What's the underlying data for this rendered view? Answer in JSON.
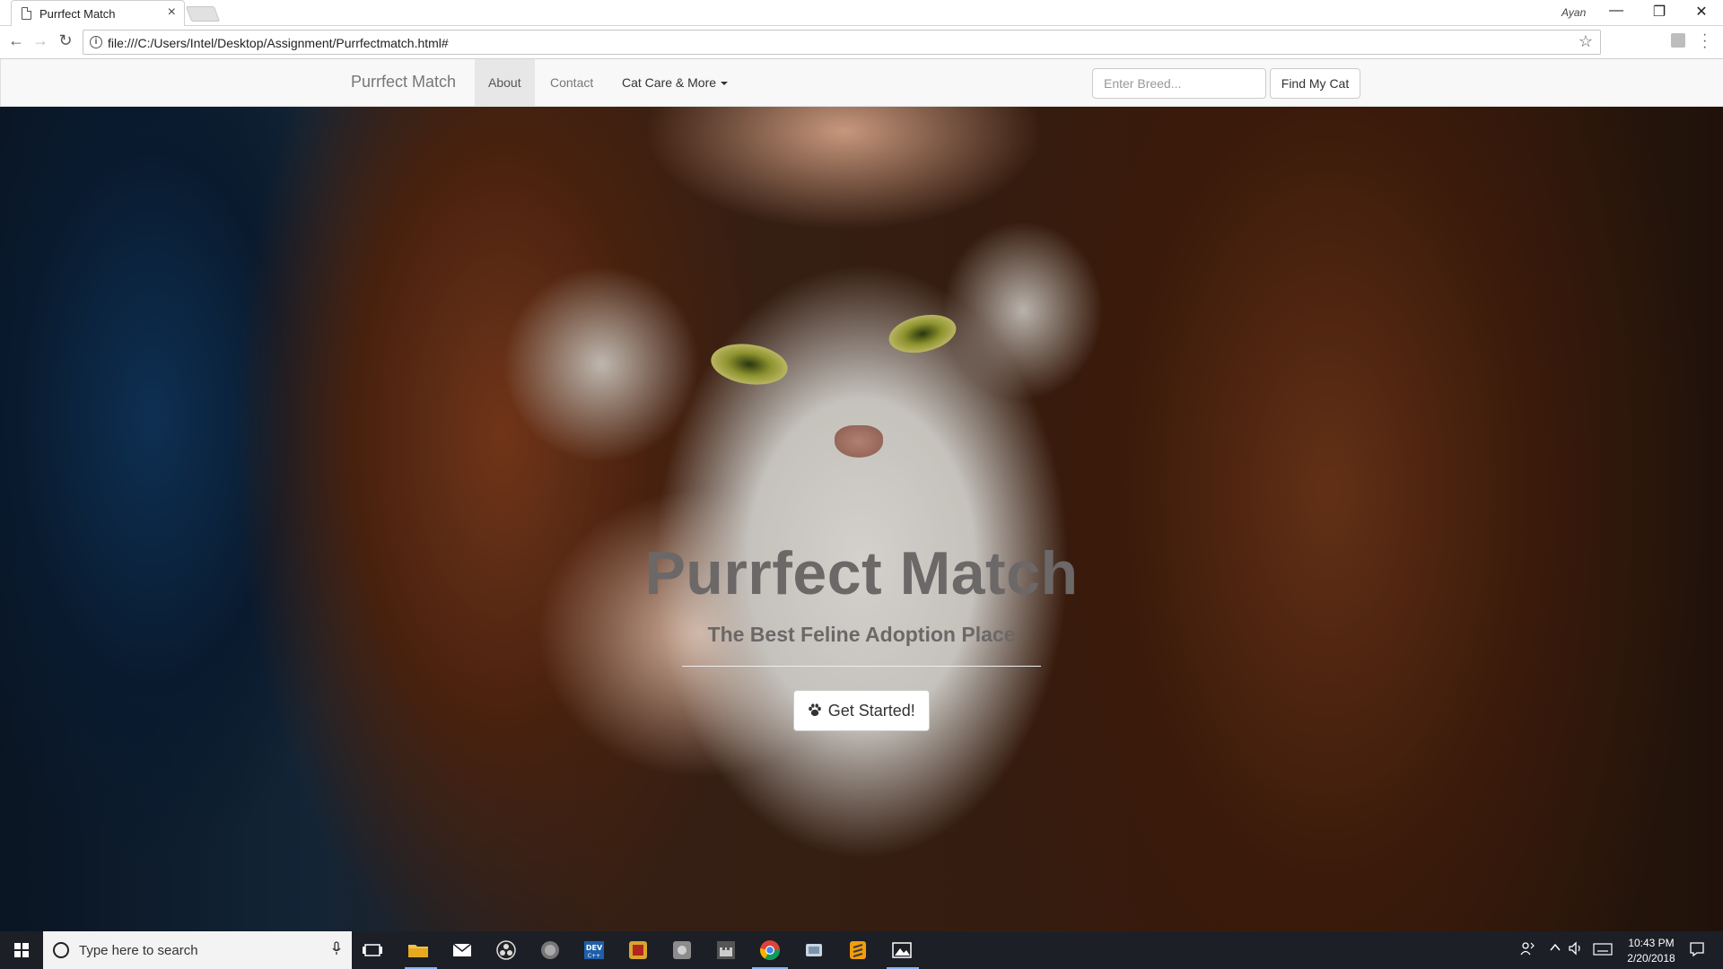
{
  "browser": {
    "tab_title": "Purrfect Match",
    "tab_close": "×",
    "profile_name": "Ayan",
    "url": "file:///C:/Users/Intel/Desktop/Assignment/Purrfectmatch.html#",
    "window_buttons": {
      "minimize": "—",
      "restore": "❐",
      "close": "✕"
    },
    "nav_icons": {
      "back": "←",
      "forward": "→",
      "reload": "↻",
      "info": "i",
      "bookmark": "☆"
    }
  },
  "site": {
    "brand": "Purrfect Match",
    "nav": {
      "about": "About",
      "contact": "Contact",
      "care": "Cat Care & More"
    },
    "search": {
      "placeholder": "Enter Breed...",
      "button": "Find My Cat"
    },
    "hero": {
      "title": "Purrfect Match",
      "subtitle": "The Best Feline Adoption Place",
      "cta_icon": "paw-icon",
      "cta_label": "Get Started!"
    }
  },
  "taskbar": {
    "search_placeholder": "Type here to search",
    "time": "10:43 PM",
    "date": "2/20/2018",
    "apps": [
      "task-view",
      "file-explorer",
      "mail",
      "obs",
      "browser-globe",
      "dev-cpp",
      "app-gold",
      "app-gray",
      "app-castle",
      "chrome",
      "app-cards",
      "sublime-text",
      "photos"
    ]
  },
  "colors": {
    "navbar_bg": "#f8f8f8",
    "nav_active_bg": "#e7e7e7",
    "hero_text": "#6c6868",
    "taskbar_bg": "#1c1f26"
  }
}
